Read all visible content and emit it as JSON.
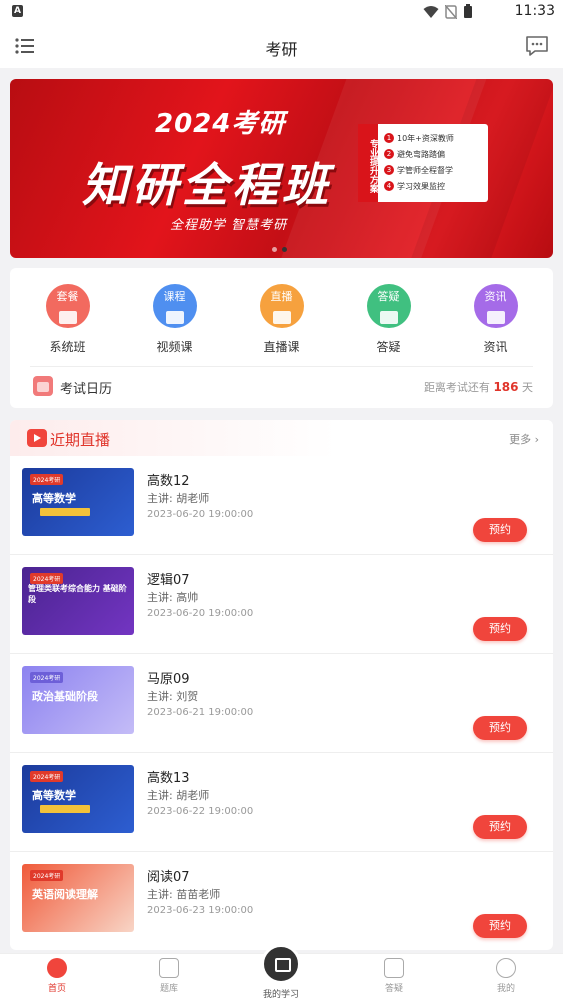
{
  "status_bar": {
    "time": "11:33",
    "app_badge": "A"
  },
  "header": {
    "title": "考研",
    "menu_icon": "list-icon",
    "message_icon": "chat-bubble-icon"
  },
  "banner": {
    "year_line": "2024考研",
    "main_title": "知研全程班",
    "subtitle": "全程助学  智慧考研",
    "side_label": "专业提升方案",
    "points": [
      "10年+资深教师",
      "避免弯路踏偏",
      "学管师全程督学",
      "学习效果监控"
    ],
    "carousel_dots": 2,
    "active_dot": 2
  },
  "quick_nav": [
    {
      "icon_text": "套餐",
      "label": "系统班",
      "color": "#f26a5f",
      "icon": "graduation-cap-icon"
    },
    {
      "icon_text": "课程",
      "label": "视频课",
      "color": "#4f8ff0",
      "icon": "video-play-icon"
    },
    {
      "icon_text": "直播",
      "label": "直播课",
      "color": "#f6a13e",
      "icon": "live-icon"
    },
    {
      "icon_text": "答疑",
      "label": "答疑",
      "color": "#40c080",
      "icon": "qa-chat-icon"
    },
    {
      "icon_text": "资讯",
      "label": "资讯",
      "color": "#a56be8",
      "icon": "news-icon"
    }
  ],
  "exam_calendar": {
    "label": "考试日历",
    "countdown_prefix": "距离考试还有",
    "days": "186",
    "unit": "天"
  },
  "live_section": {
    "title": "近期直播",
    "more": "更多 ›",
    "items": [
      {
        "name": "高数12",
        "teacher": "主讲: 胡老师",
        "time": "2023-06-20 19:00:00",
        "button": "预约",
        "thumb_title": "高等数学",
        "thumb_tag": "2024考研",
        "thumb_style": "blue"
      },
      {
        "name": "逻辑07",
        "teacher": "主讲: 高帅",
        "time": "2023-06-20 19:00:00",
        "button": "预约",
        "thumb_title": "管理类联考综合能力 基础阶段",
        "thumb_tag": "2024考研",
        "thumb_style": "purple"
      },
      {
        "name": "马原09",
        "teacher": "主讲: 刘贺",
        "time": "2023-06-21 19:00:00",
        "button": "预约",
        "thumb_title": "政治基础阶段",
        "thumb_tag": "2024考研",
        "thumb_style": "lav"
      },
      {
        "name": "高数13",
        "teacher": "主讲: 胡老师",
        "time": "2023-06-22 19:00:00",
        "button": "预约",
        "thumb_title": "高等数学",
        "thumb_tag": "2024考研",
        "thumb_style": "blue"
      },
      {
        "name": "阅读07",
        "teacher": "主讲: 苗苗老师",
        "time": "2023-06-23 19:00:00",
        "button": "预约",
        "thumb_title": "英语阅读理解",
        "thumb_tag": "2024考研",
        "thumb_style": "red"
      }
    ]
  },
  "tabbar": {
    "tabs": [
      {
        "label": "首页",
        "icon": "home-icon",
        "active": true
      },
      {
        "label": "题库",
        "icon": "edit-icon",
        "active": false
      },
      {
        "label": "我的学习",
        "icon": "play-icon",
        "active": false
      },
      {
        "label": "答疑",
        "icon": "chat-icon",
        "active": false
      },
      {
        "label": "我的",
        "icon": "user-icon",
        "active": false
      }
    ]
  }
}
